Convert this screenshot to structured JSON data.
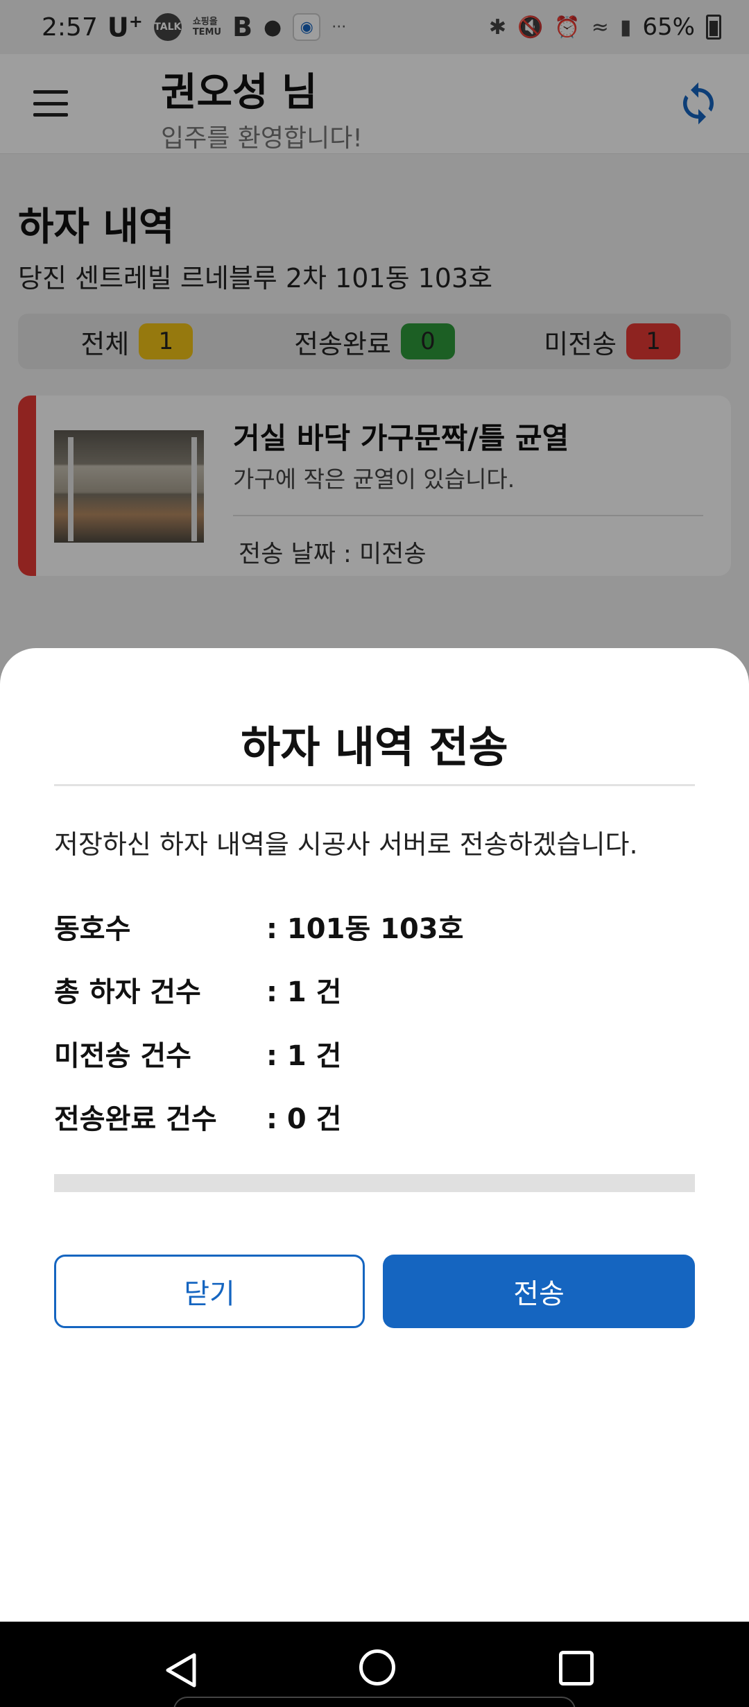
{
  "status_bar": {
    "time": "2:57",
    "carrier": "U",
    "carrier_plus": "+",
    "talk": "TALK",
    "temu_top": "쇼핑을",
    "temu_bottom": "TEMU",
    "battery": "65%",
    "more": "···"
  },
  "header": {
    "user_name": "권오성 님",
    "welcome": "입주를 환영합니다!"
  },
  "page": {
    "title": "하자 내역",
    "subtitle": "당진 센트레빌 르네블루 2차 101동 103호",
    "filters": [
      {
        "label": "전체",
        "count": "1"
      },
      {
        "label": "전송완료",
        "count": "0"
      },
      {
        "label": "미전송",
        "count": "1"
      }
    ],
    "cards": [
      {
        "title": "거실 바닥 가구문짝/틀 균열",
        "description": "가구에 작은 균열이 있습니다.",
        "date_line": "전송 날짜 : 미전송",
        "status_color": "#e53935"
      }
    ]
  },
  "dialog": {
    "title": "하자 내역 전송",
    "message": "저장하신 하자 내역을 시공사 서버로 전송하겠습니다.",
    "rows": [
      {
        "label": "동호수",
        "value": ": 101동 103호"
      },
      {
        "label": "총 하자 건수",
        "value": ": 1 건"
      },
      {
        "label": "미전송 건수",
        "value": ": 1 건"
      },
      {
        "label": "전송완료 건수",
        "value": ": 0 건"
      }
    ],
    "progress": 0,
    "close_label": "닫기",
    "send_label": "전송"
  },
  "colors": {
    "accent": "#1565c0",
    "yellow": "#f3c417",
    "green": "#2e9a3b",
    "red": "#e53935"
  }
}
